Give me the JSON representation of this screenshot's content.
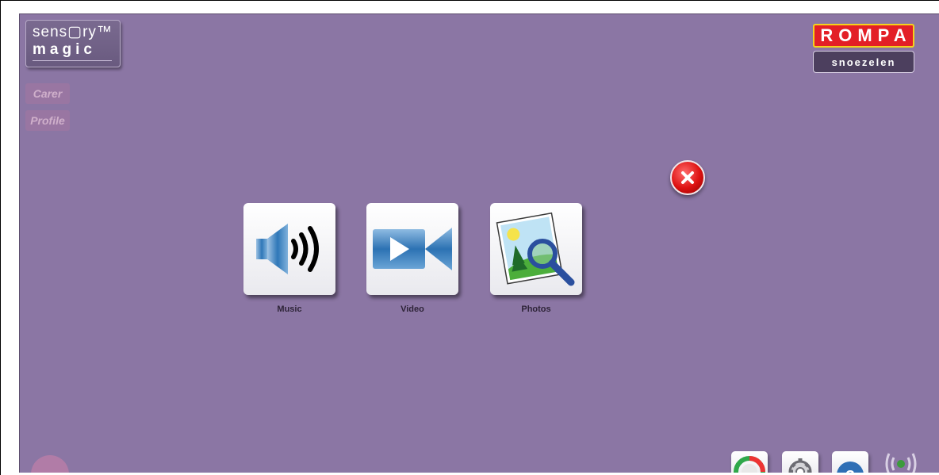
{
  "brand": {
    "logo_line1": "sens▢ry™",
    "logo_line2": "magic",
    "partner_logo": "ROMPA",
    "partner_sub": "snoezelen"
  },
  "side_buttons": {
    "carer": "Carer",
    "profile": "Profile"
  },
  "apps": [
    {
      "label": "Music",
      "icon": "speaker-icon"
    },
    {
      "label": "Video",
      "icon": "video-camera-icon"
    },
    {
      "label": "Photos",
      "icon": "photo-magnifier-icon"
    }
  ],
  "bottom_icons": [
    "timer-icon",
    "gear-icon",
    "help-icon",
    "wireless-icon"
  ],
  "colors": {
    "background": "#8b76a4",
    "close": "#dd1111",
    "rompa_red": "#e31f26",
    "rompa_yellow": "#f4d21c"
  }
}
